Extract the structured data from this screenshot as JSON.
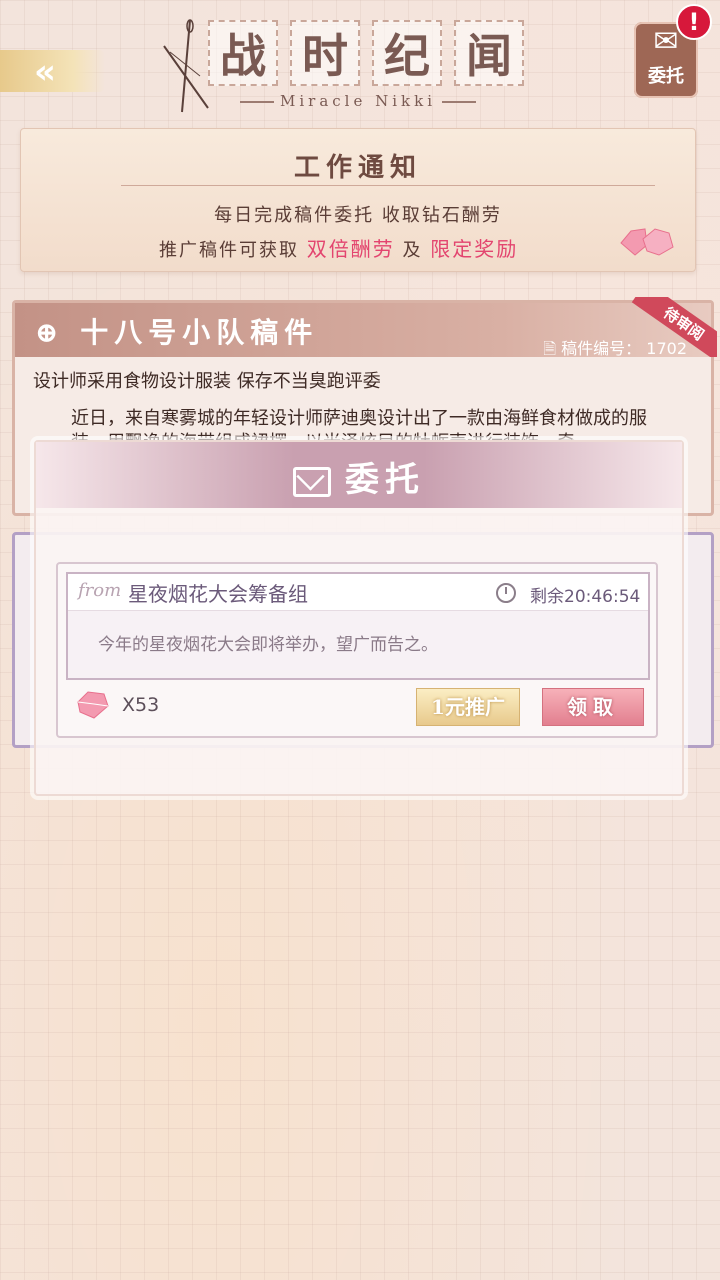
{
  "header": {
    "back_glyph": "«",
    "title_chars": [
      "战",
      "时",
      "纪",
      "闻"
    ],
    "subtitle": "Miracle Nikki",
    "task_button_label": "委托",
    "alert_glyph": "!"
  },
  "notice": {
    "title": "工作通知",
    "line1": "每日完成稿件委托 收取钻石酬劳",
    "line2_prefix": "推广稿件可获取",
    "line2_highlight1": "双倍酬劳",
    "line2_mid": "及",
    "line2_highlight2": "限定奖励"
  },
  "manuscript": {
    "title": "十八号小队稿件",
    "number_label": "稿件编号：",
    "number": "1702",
    "ribbon": "待审阅",
    "headline": "设计师采用食物设计服装 保存不当臭跑评委",
    "body": "近日，来自寒雾城的年轻设计师萨迪奥设计出了一款由海鲜食材做成的服装，用飘逸的海带组成裙摆，以光泽炫目的牡蛎壳进行装饰，奇"
  },
  "modal": {
    "title": "委托",
    "from_label": "from",
    "sender": "星夜烟花大会筹备组",
    "timer": "剩余20:46:54",
    "message": "今年的星夜烟花大会即将举办，望广而告之。",
    "reward": "X53",
    "promote_button": "1元推广",
    "claim_button": "领取"
  },
  "colors": {
    "accent_pink": "#e3456f",
    "alert_red": "#d7183b",
    "brown_text": "#6e4a40"
  }
}
